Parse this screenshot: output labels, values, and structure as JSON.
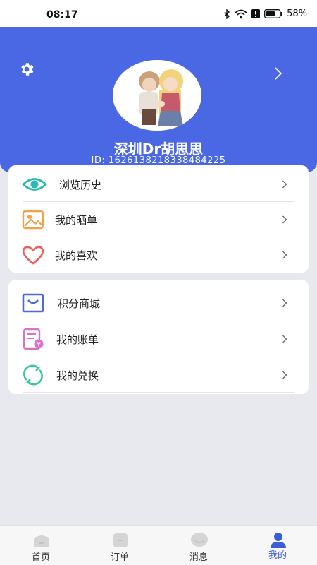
{
  "status": {
    "time": "08:17",
    "battery": "58%"
  },
  "profile": {
    "name": "深圳Dr胡思思",
    "id": "ID:  1626138218338484225"
  },
  "menu_group1": [
    {
      "label": "浏览历史",
      "icon": "eye-icon"
    },
    {
      "label": "我的晒单",
      "icon": "image-icon"
    },
    {
      "label": "我的喜欢",
      "icon": "heart-icon"
    }
  ],
  "menu_group2": [
    {
      "label": "积分商城",
      "icon": "shopping-bag-icon"
    },
    {
      "label": "我的账单",
      "icon": "bill-icon"
    },
    {
      "label": "我的兑换",
      "icon": "exchange-icon"
    }
  ],
  "tabs": [
    {
      "label": "首页",
      "icon": "home-icon"
    },
    {
      "label": "订单",
      "icon": "order-icon"
    },
    {
      "label": "消息",
      "icon": "message-icon"
    },
    {
      "label": "我的",
      "icon": "user-icon"
    }
  ],
  "colors": {
    "header": "#4a67e4",
    "active_tab": "#3b5ed8",
    "background": "#e8e9ee"
  }
}
